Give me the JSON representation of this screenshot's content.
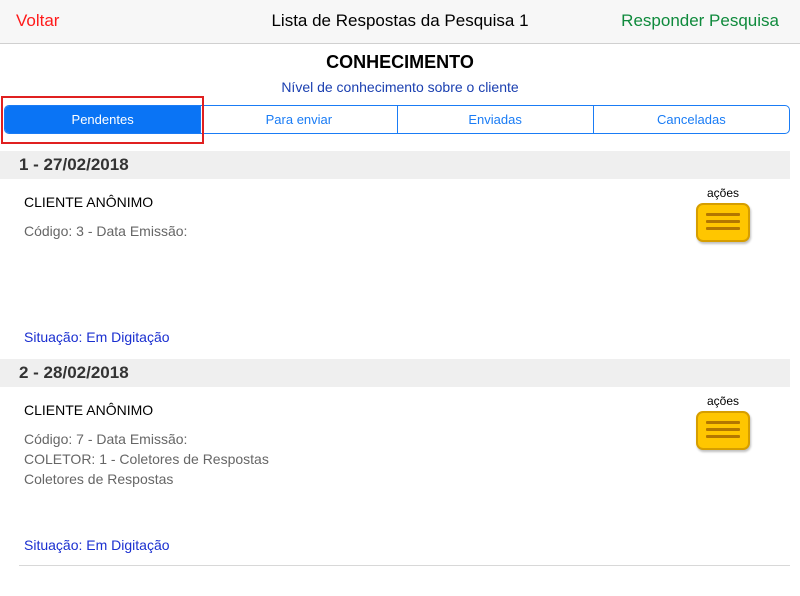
{
  "navbar": {
    "back_label": "Voltar",
    "title": "Lista de Respostas da Pesquisa 1",
    "action_label": "Responder Pesquisa"
  },
  "survey": {
    "title": "CONHECIMENTO",
    "subtitle": "Nível de conhecimento sobre o cliente"
  },
  "tabs": [
    {
      "label": "Pendentes",
      "selected": true
    },
    {
      "label": "Para enviar",
      "selected": false
    },
    {
      "label": "Enviadas",
      "selected": false
    },
    {
      "label": "Canceladas",
      "selected": false
    }
  ],
  "responses": [
    {
      "header": "1 - 27/02/2018",
      "client": "CLIENTE ANÔNIMO",
      "details": [
        "Código: 3 - Data Emissão:"
      ],
      "status": "Situação: Em Digitação",
      "actions_label": "ações"
    },
    {
      "header": "2 - 28/02/2018",
      "client": "CLIENTE ANÔNIMO",
      "details": [
        "Código: 7 - Data Emissão:",
        "COLETOR: 1 - Coletores de Respostas",
        "Coletores de Respostas"
      ],
      "status": "Situação: Em Digitação",
      "actions_label": "ações"
    }
  ],
  "colors": {
    "back": "#ff1a1a",
    "action": "#0f8a3c",
    "accent": "#0a74f5",
    "status": "#1a2fd0",
    "actions_button": "#ffc600",
    "highlight": "#e02020"
  },
  "icons": {
    "actions": "menu-lines-icon"
  }
}
